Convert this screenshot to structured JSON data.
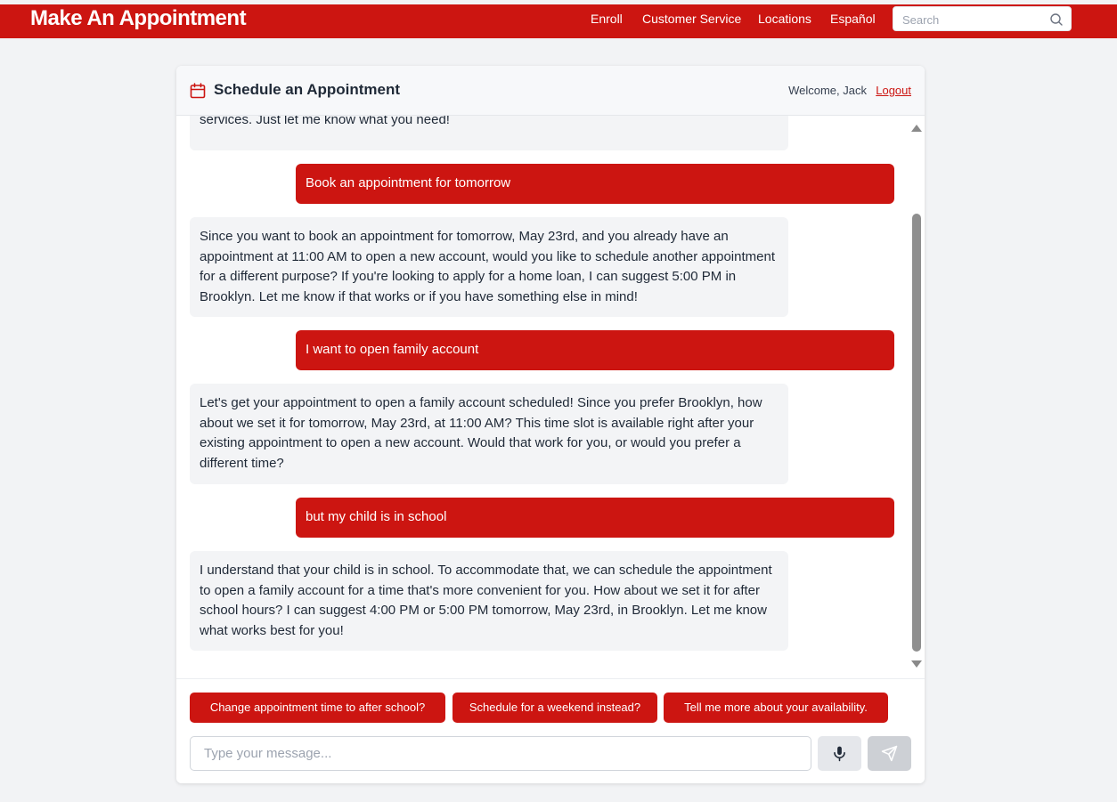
{
  "header": {
    "brand": "Make An Appointment",
    "nav": [
      "Enroll",
      "Customer Service",
      "Locations",
      "Español"
    ],
    "search_placeholder": "Search"
  },
  "card": {
    "title": "Schedule an Appointment",
    "welcome": "Welcome, Jack",
    "logout": "Logout"
  },
  "messages": [
    {
      "role": "bot",
      "text": "services. Just let me know what you need!"
    },
    {
      "role": "user",
      "text": "Book an appointment for tomorrow"
    },
    {
      "role": "bot",
      "text": "Since you want to book an appointment for tomorrow, May 23rd, and you already have an appointment at 11:00 AM to open a new account, would you like to schedule another appointment for a different purpose? If you're looking to apply for a home loan, I can suggest 5:00 PM in Brooklyn. Let me know if that works or if you have something else in mind!"
    },
    {
      "role": "user",
      "text": "I want to open family account"
    },
    {
      "role": "bot",
      "text": "Let's get your appointment to open a family account scheduled! Since you prefer Brooklyn, how about we set it for tomorrow, May 23rd, at 11:00 AM? This time slot is available right after your existing appointment to open a new account. Would that work for you, or would you prefer a different time?"
    },
    {
      "role": "user",
      "text": "but my child is in school"
    },
    {
      "role": "bot",
      "text": "I understand that your child is in school. To accommodate that, we can schedule the appointment to open a family account for a time that's more convenient for you. How about we set it for after school hours? I can suggest 4:00 PM or 5:00 PM tomorrow, May 23rd, in Brooklyn. Let me know what works best for you!"
    }
  ],
  "suggestions": [
    "Change appointment time to after school?",
    "Schedule for a weekend instead?",
    "Tell me more about your availability."
  ],
  "composer": {
    "placeholder": "Type your message..."
  },
  "colors": {
    "brand_red": "#cc1511",
    "bot_bubble": "#f3f4f6",
    "page_bg": "#f2f3f5"
  }
}
